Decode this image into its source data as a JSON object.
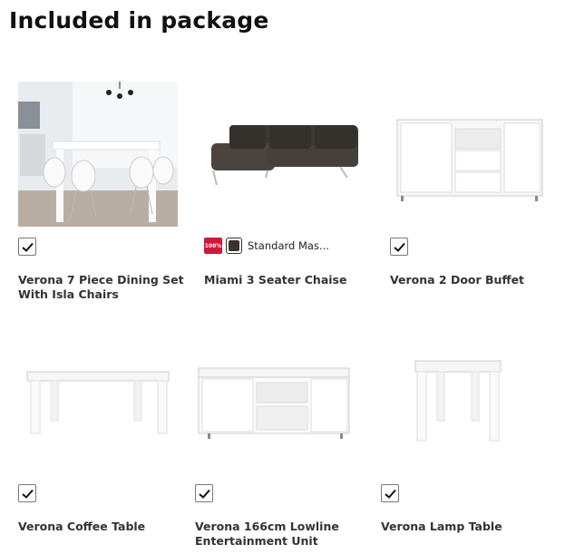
{
  "section_title": "Included in package",
  "products": [
    {
      "name": "Verona 7 Piece Dining Set With Isla Chairs",
      "checked": true
    },
    {
      "name": "Miami 3 Seater Chaise",
      "badge_text": "100%",
      "color_name": "Standard Mas...",
      "color_hex": "#3b332c"
    },
    {
      "name": "Verona 2 Door Buffet",
      "checked": true
    },
    {
      "name": "Verona Coffee Table",
      "checked": true
    },
    {
      "name": "Verona 166cm Lowline Entertainment Unit",
      "checked": true
    },
    {
      "name": "Verona Lamp Table",
      "checked": true
    }
  ]
}
